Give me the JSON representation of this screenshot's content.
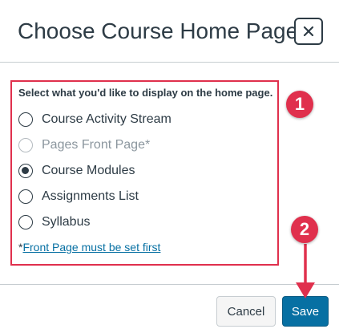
{
  "dialog": {
    "title": "Choose Course Home Page",
    "close_icon": "close-icon"
  },
  "body": {
    "instruction": "Select what you'd like to display on the home page.",
    "options": [
      {
        "label": "Course Activity Stream",
        "selected": false,
        "disabled": false
      },
      {
        "label": "Pages Front Page*",
        "selected": false,
        "disabled": true
      },
      {
        "label": "Course Modules",
        "selected": true,
        "disabled": false
      },
      {
        "label": "Assignments List",
        "selected": false,
        "disabled": false
      },
      {
        "label": "Syllabus",
        "selected": false,
        "disabled": false
      }
    ],
    "footnote_prefix": "*",
    "footnote_link": "Front Page must be set first"
  },
  "annotations": {
    "step1": "1",
    "step2": "2",
    "color": "#e0304d"
  },
  "footer": {
    "cancel_label": "Cancel",
    "save_label": "Save"
  },
  "colors": {
    "text": "#2d3b45",
    "link": "#0770a3",
    "primary_button": "#0770a3",
    "disabled_text": "#8b969e"
  }
}
